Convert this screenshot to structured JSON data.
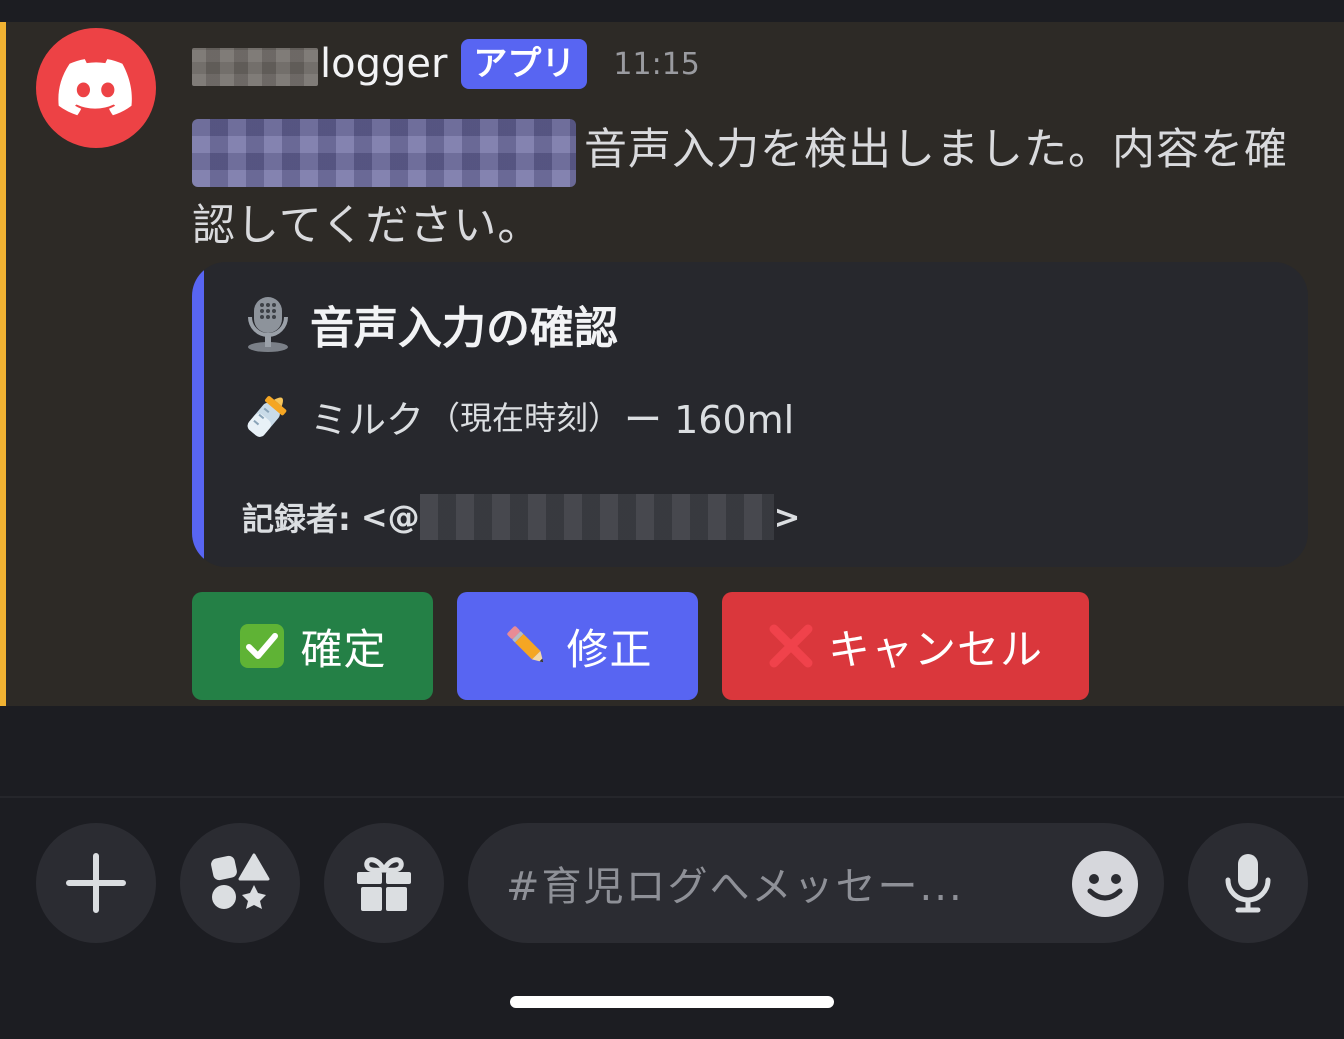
{
  "message": {
    "username": "logger",
    "app_badge": "アプリ",
    "timestamp": "11:15",
    "text": "音声入力を検出しました。内容を確認してください。",
    "embed": {
      "title_icon": "microphone-icon",
      "title": "音声入力の確認",
      "line_icon": "baby-bottle-icon",
      "item": "ミルク",
      "time_note": "（現在時刻）",
      "amount": "ー 160ml",
      "footer_label": "記録者:",
      "footer_open": "<@",
      "footer_close": ">"
    },
    "buttons": {
      "confirm_label": "確定",
      "edit_label": "修正",
      "cancel_label": "キャンセル"
    }
  },
  "composer": {
    "placeholder": "#育児ログへメッセー..."
  },
  "colors": {
    "accent_bar": "#f0b232",
    "brand": "#5865f2",
    "confirm": "#248046",
    "cancel": "#da373c",
    "avatar_bg": "#ed4245"
  }
}
